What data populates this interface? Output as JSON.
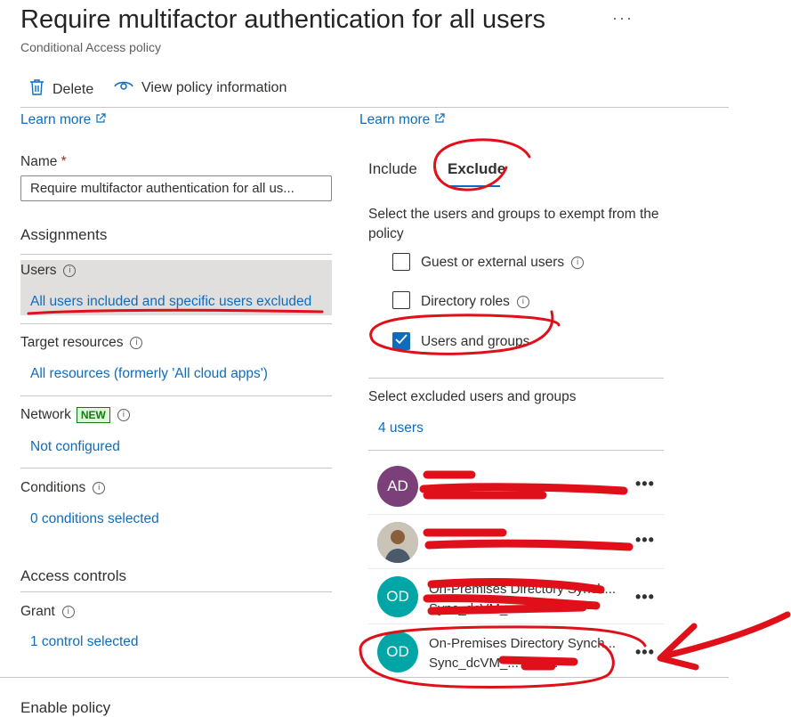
{
  "header": {
    "title": "Require multifactor authentication for all users",
    "more": "···",
    "subtitle": "Conditional Access policy"
  },
  "toolbar": {
    "delete_label": "Delete",
    "view_info_label": "View policy information"
  },
  "left": {
    "learn_more": "Learn more",
    "name_label": "Name",
    "name_required": "*",
    "name_value": "Require multifactor authentication for all us...",
    "assignments_title": "Assignments",
    "users": {
      "label": "Users",
      "value": "All users included and specific users excluded"
    },
    "target_resources": {
      "label": "Target resources",
      "value": "All resources (formerly 'All cloud apps')"
    },
    "network": {
      "label": "Network",
      "badge": "NEW",
      "value": "Not configured"
    },
    "conditions": {
      "label": "Conditions",
      "value": "0 conditions selected"
    },
    "access_controls_title": "Access controls",
    "grant": {
      "label": "Grant",
      "value": "1 control selected"
    },
    "enable_policy_label": "Enable policy"
  },
  "right": {
    "learn_more": "Learn more",
    "tabs": [
      {
        "label": "Include"
      },
      {
        "label": "Exclude"
      }
    ],
    "description": "Select the users and groups to exempt from the policy",
    "options": [
      {
        "label": "Guest or external users",
        "checked": false
      },
      {
        "label": "Directory roles",
        "checked": false
      },
      {
        "label": "Users and groups",
        "checked": true
      }
    ],
    "select_excluded_label": "Select excluded users and groups",
    "users_count": "4 users",
    "users": [
      {
        "initials": "AD",
        "color": "#7b3f7a",
        "line1": "",
        "line2": ""
      },
      {
        "initials": "",
        "color": "#8a8886",
        "line1": "",
        "line2": ""
      },
      {
        "initials": "OD",
        "color": "#00a5a5",
        "line1": "On-Premises Directory Synch...",
        "line2": "Sync_dcVM_..."
      },
      {
        "initials": "OD",
        "color": "#00a5a5",
        "line1": "On-Premises Directory Synch...",
        "line2": "Sync_dcVM_...7d@..."
      }
    ],
    "row_more": "•••"
  },
  "colors": {
    "link": "#0f6cbd",
    "annotation": "#e0101a",
    "accent": "#0f6cbd"
  }
}
